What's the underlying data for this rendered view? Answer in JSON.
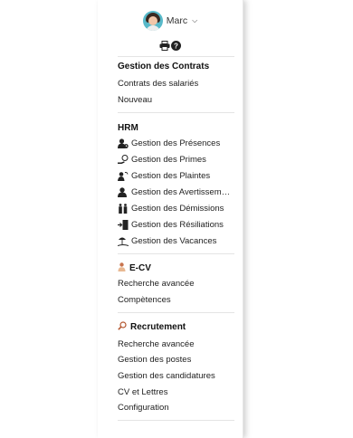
{
  "user": {
    "name": "Marc"
  },
  "contracts": {
    "heading": "Gestion des Contrats",
    "items": [
      "Contrats des salariés",
      "Nouveau"
    ]
  },
  "hrm": {
    "heading": "HRM",
    "items": [
      {
        "label": "Gestion des Présences",
        "icon": "user-clock-icon"
      },
      {
        "label": "Gestion des Primes",
        "icon": "hand-coin-icon"
      },
      {
        "label": "Gestion des Plaintes",
        "icon": "user-complaint-icon"
      },
      {
        "label": "Gestion des Avertissem…",
        "icon": "user-warning-icon"
      },
      {
        "label": "Gestion des Démissions",
        "icon": "user-resign-icon"
      },
      {
        "label": "Gestion des Résiliations",
        "icon": "door-exit-icon"
      },
      {
        "label": "Gestion des Vacances",
        "icon": "beach-umbrella-icon"
      }
    ]
  },
  "ecv": {
    "heading": "E-CV",
    "icon": "cv-person-icon",
    "items": [
      "Recherche avancée",
      "Compètences"
    ]
  },
  "recruitment": {
    "heading": "Recrutement",
    "icon": "magnifier-icon",
    "items": [
      "Recherche avancée",
      "Gestion des postes",
      "Gestion des candidatures",
      "CV et Lettres",
      "Configuration"
    ]
  }
}
